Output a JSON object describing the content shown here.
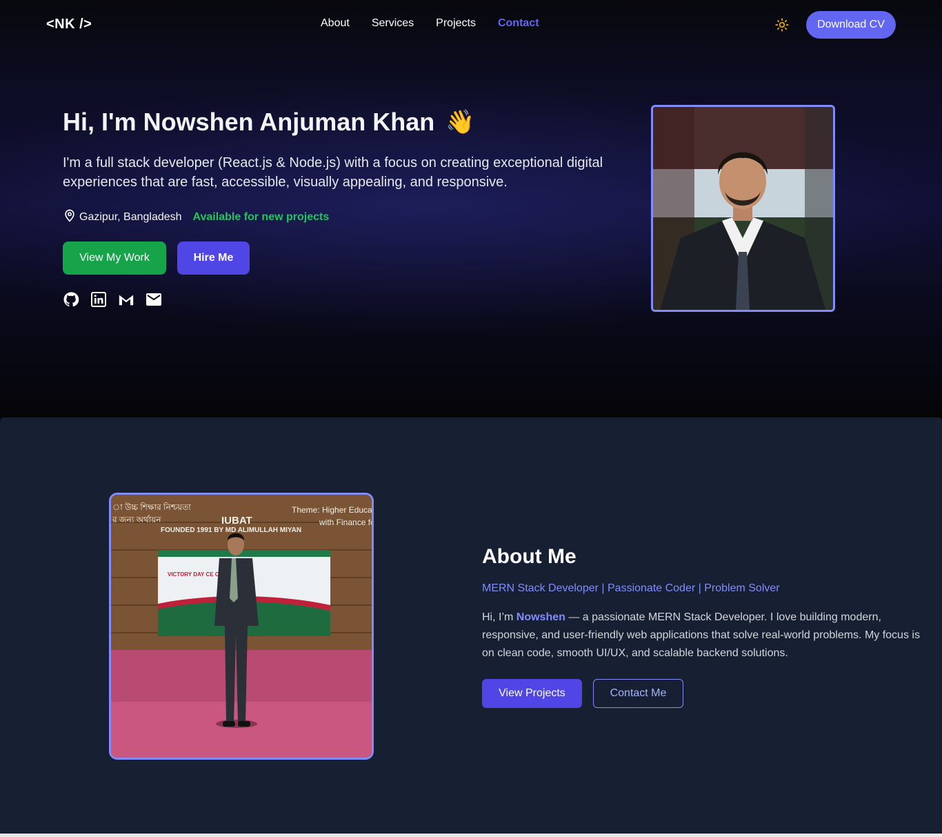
{
  "nav": {
    "logo": "<NK />",
    "links": [
      "About",
      "Services",
      "Projects",
      "Contact"
    ],
    "active_link": "Contact",
    "theme_icon": "sun-icon",
    "download_label": "Download CV"
  },
  "hero": {
    "title": "Hi, I'm Nowshen Anjuman Khan",
    "wave_emoji": "👋",
    "description": "I'm a full stack developer (React.js & Node.js) with a focus on creating exceptional digital experiences that are fast, accessible, visually appealing, and responsive.",
    "location": "Gazipur, Bangladesh",
    "availability": "Available for new projects",
    "primary_button": "View My Work",
    "secondary_button": "Hire Me",
    "social_icons": [
      "github-icon",
      "linkedin-icon",
      "gmail-icon",
      "mail-icon"
    ]
  },
  "about": {
    "title": "About Me",
    "subtitle": "MERN Stack Developer | Passionate Coder | Problem Solver",
    "text_intro": "Hi, I’m ",
    "text_name": "Nowshen",
    "text_rest": " — a passionate MERN Stack Developer. I love building modern, responsive, and user-friendly web applications that solve real-world problems. My focus is on clean code, smooth UI/UX, and scalable backend solutions.",
    "primary_button": "View Projects",
    "secondary_button": "Contact Me",
    "photo_sign": {
      "line1": "IUBAT",
      "line2": "FOUNDED 1991 BY MD ALIMULLAH MIYAN",
      "theme_line1": "Theme: Higher Educati",
      "theme_line2": "with Finance fo",
      "bangla_line1": "া উচ্চ শিক্ষার নিশ্চয়তা",
      "bangla_line2": "র জন্য অর্থায়ন",
      "banner": "VICTORY DAY CE OF BA"
    }
  },
  "colors": {
    "accent": "#6366f1",
    "accent_light": "#818cf8",
    "green": "#16a34a",
    "available_green": "#22c55e",
    "about_bg": "#172033"
  }
}
